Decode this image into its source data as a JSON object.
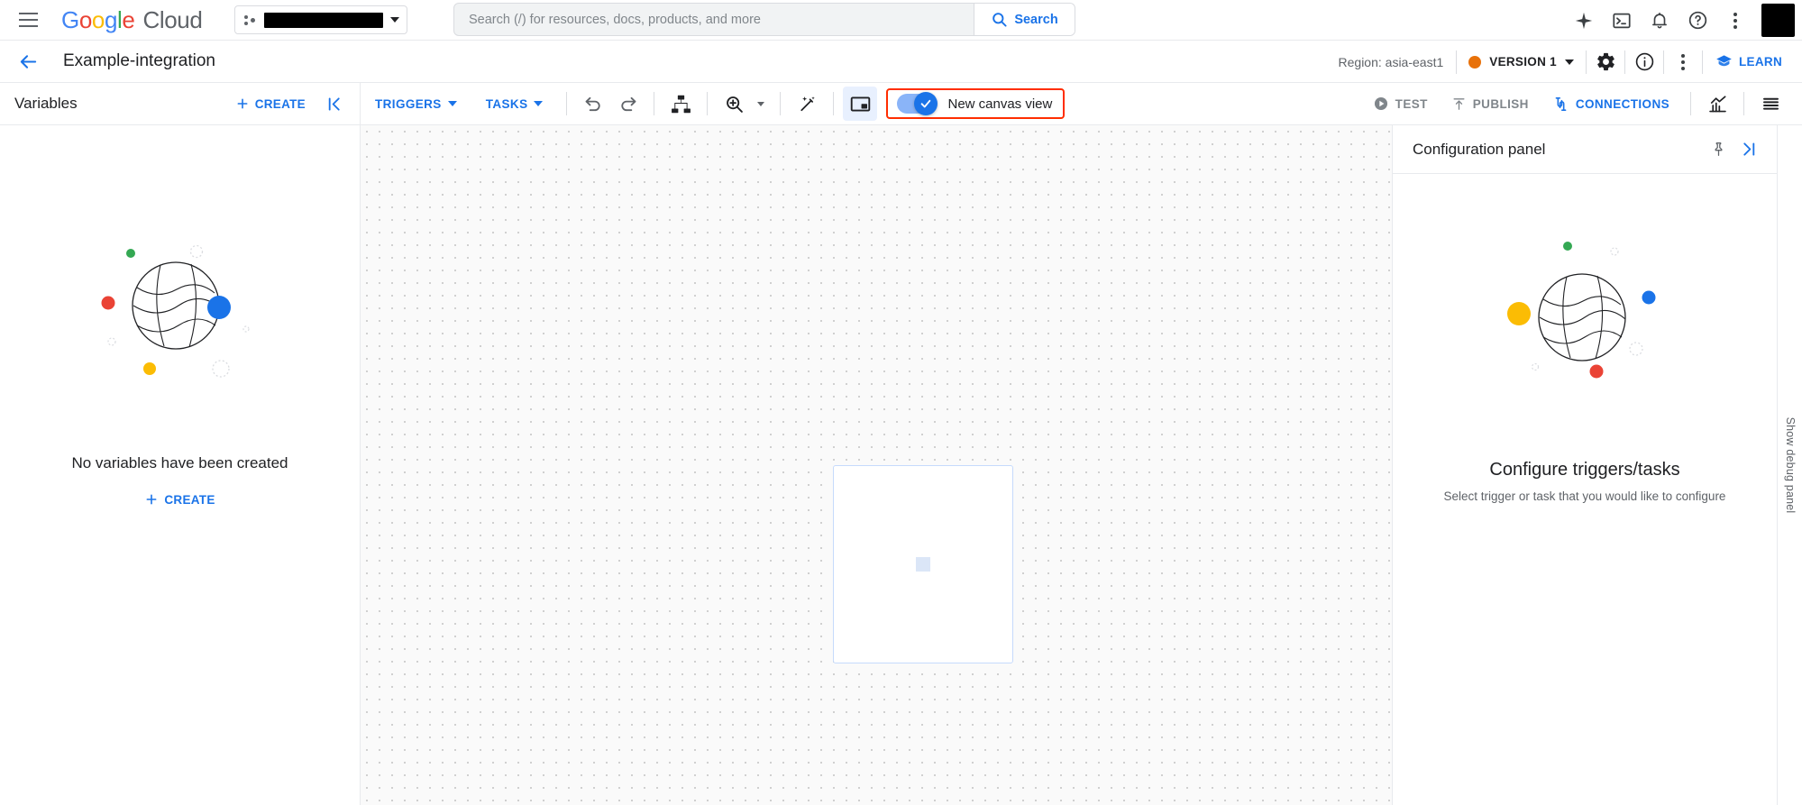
{
  "topbar": {
    "menu_icon": "hamburger-menu-icon",
    "logo": {
      "g1": "G",
      "o1": "o",
      "o2": "o",
      "g2": "g",
      "l": "l",
      "e": "e",
      "cloud": "Cloud"
    },
    "project_picker": {
      "value": "",
      "redacted": true,
      "icon": "project-dots-icon"
    },
    "search": {
      "placeholder": "Search (/) for resources, docs, products, and more",
      "value": "",
      "button_label": "Search",
      "icon": "search-icon"
    },
    "icons": [
      {
        "name": "gemini-sparkle-icon",
        "title": "Gemini"
      },
      {
        "name": "cloud-shell-icon",
        "title": "Activate Cloud Shell"
      },
      {
        "name": "notifications-bell-icon",
        "title": "Notifications"
      },
      {
        "name": "help-question-icon",
        "title": "Help and support"
      },
      {
        "name": "more-vert-icon",
        "title": "More options"
      }
    ],
    "avatar": {
      "name": "account-avatar",
      "redacted": true
    }
  },
  "integration_header": {
    "back_icon": "back-arrow-icon",
    "title": "Example-integration",
    "region_label": "Region: asia-east1",
    "version": {
      "label": "VERSION 1",
      "status_color": "#e8710a",
      "dropdown": true
    },
    "icons": [
      {
        "name": "settings-gear-icon",
        "title": "Settings"
      },
      {
        "name": "info-circle-icon",
        "title": "Info"
      },
      {
        "name": "more-vert-icon",
        "title": "More"
      }
    ],
    "learn": {
      "label": "LEARN",
      "icon": "learn-book-icon"
    }
  },
  "toolbar": {
    "variables_title": "Variables",
    "variables_create": {
      "label": "CREATE",
      "icon": "plus-icon"
    },
    "collapse_icon": "collapse-left-icon",
    "triggers": {
      "label": "TRIGGERS",
      "has_dropdown": true
    },
    "tasks": {
      "label": "TASKS",
      "has_dropdown": true
    },
    "undo_icon": "undo-icon",
    "redo_icon": "redo-icon",
    "layout_icon": "auto-layout-icon",
    "zoom": {
      "icon": "zoom-in-icon",
      "has_dropdown": true
    },
    "magic_icon": "magic-wand-icon",
    "minimap_icon": "picture-in-picture-icon",
    "canvas_toggle": {
      "label": "New canvas view",
      "enabled": true,
      "highlight_color": "#ff2d00"
    },
    "test": {
      "label": "TEST",
      "icon": "play-circle-icon",
      "disabled": true
    },
    "publish": {
      "label": "PUBLISH",
      "icon": "publish-up-icon",
      "disabled": true
    },
    "connections": {
      "label": "CONNECTIONS",
      "icon": "connections-icon",
      "disabled": false
    },
    "analytics_icon": "analytics-chart-icon",
    "logs_icon": "logs-list-icon"
  },
  "variables_panel": {
    "illustration": "empty-state-globe-illustration",
    "empty_message": "No variables have been created",
    "create": {
      "label": "CREATE",
      "icon": "plus-icon"
    }
  },
  "canvas": {
    "node_placeholder": "canvas-node-card"
  },
  "config_panel": {
    "title": "Configuration panel",
    "pin_icon": "pin-icon",
    "collapse_icon": "collapse-right-icon",
    "illustration": "empty-state-globe-illustration",
    "heading": "Configure triggers/tasks",
    "subtext": "Select trigger or task that you would like to configure"
  },
  "right_rail": {
    "label": "Show debug panel"
  }
}
